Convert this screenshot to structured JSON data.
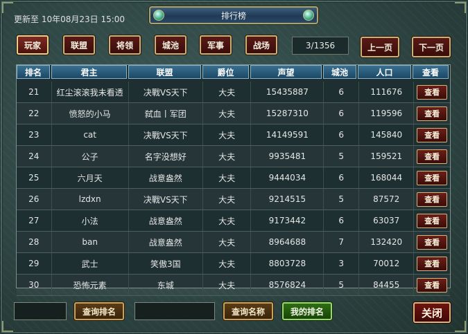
{
  "header": {
    "update_text": "更新至 10年08月23日 15:00",
    "title": "排行榜"
  },
  "tabs": [
    {
      "label": "玩家",
      "active": true
    },
    {
      "label": "联盟",
      "active": false
    },
    {
      "label": "将领",
      "active": false
    },
    {
      "label": "城池",
      "active": false
    },
    {
      "label": "军事",
      "active": false
    },
    {
      "label": "战场",
      "active": false
    }
  ],
  "pagination": {
    "page_indicator": "3/1356",
    "prev_label": "上一页",
    "next_label": "下一页"
  },
  "table": {
    "columns": [
      "排名",
      "君主",
      "联盟",
      "爵位",
      "声望",
      "城池",
      "人口",
      "查看"
    ],
    "rows": [
      {
        "rank": "21",
        "lord": "红尘滚滚我未看透",
        "alliance": "决戰VS天下",
        "title": "大夫",
        "prestige": "15435887",
        "cities": "6",
        "population": "111676",
        "view": "查看"
      },
      {
        "rank": "22",
        "lord": "愤怒的小马",
        "alliance": "弑血丨军团",
        "title": "大夫",
        "prestige": "15287310",
        "cities": "6",
        "population": "119596",
        "view": "查看"
      },
      {
        "rank": "23",
        "lord": "cat",
        "alliance": "决戰VS天下",
        "title": "大夫",
        "prestige": "14149591",
        "cities": "6",
        "population": "145840",
        "view": "查看"
      },
      {
        "rank": "24",
        "lord": "公子",
        "alliance": "名字没想好",
        "title": "大夫",
        "prestige": "9935481",
        "cities": "5",
        "population": "159521",
        "view": "查看"
      },
      {
        "rank": "25",
        "lord": "六月天",
        "alliance": "战意盎然",
        "title": "大夫",
        "prestige": "9444034",
        "cities": "6",
        "population": "168044",
        "view": "查看"
      },
      {
        "rank": "26",
        "lord": "lzdxn",
        "alliance": "决戰VS天下",
        "title": "大夫",
        "prestige": "9214515",
        "cities": "5",
        "population": "87572",
        "view": "查看"
      },
      {
        "rank": "27",
        "lord": "小法",
        "alliance": "战意盎然",
        "title": "大夫",
        "prestige": "9173442",
        "cities": "6",
        "population": "63037",
        "view": "查看"
      },
      {
        "rank": "28",
        "lord": "ban",
        "alliance": "战意盎然",
        "title": "大夫",
        "prestige": "8964688",
        "cities": "7",
        "population": "132420",
        "view": "查看"
      },
      {
        "rank": "29",
        "lord": "武士",
        "alliance": "笑傲3国",
        "title": "大夫",
        "prestige": "8803728",
        "cities": "3",
        "population": "70012",
        "view": "查看"
      },
      {
        "rank": "30",
        "lord": "恐怖元素",
        "alliance": "东城",
        "title": "大夫",
        "prestige": "8576824",
        "cities": "5",
        "population": "84455",
        "view": "查看"
      }
    ]
  },
  "footer": {
    "rank_input_value": "",
    "query_rank_label": "查询排名",
    "name_input_value": "",
    "query_name_label": "查询名称",
    "my_rank_label": "我的排名",
    "close_label": "关闭"
  },
  "colors": {
    "background": "#2e4644",
    "header_cell": "#2a5c7c",
    "button_red": "#4d130e",
    "button_gold": "#c9b27a",
    "button_green": "#2f6e14"
  }
}
